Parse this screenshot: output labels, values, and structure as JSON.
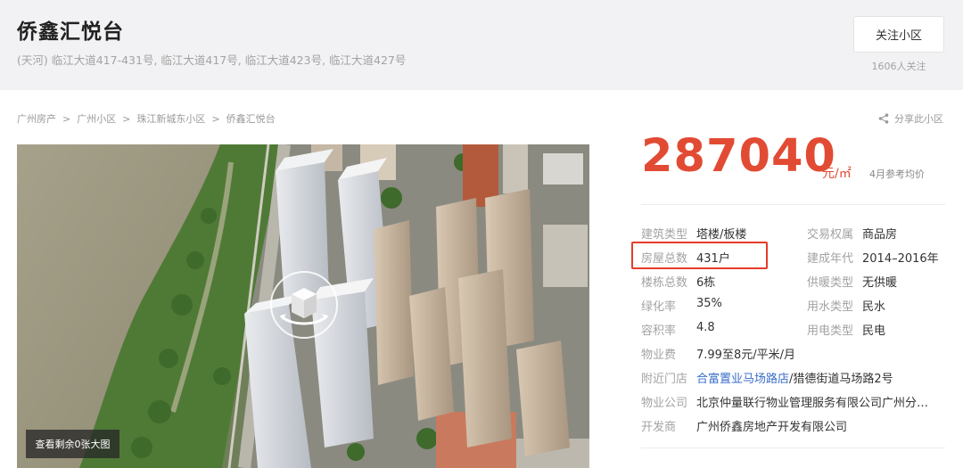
{
  "header": {
    "title": "侨鑫汇悦台",
    "address": "(天河) 临江大道417-431号, 临江大道417号, 临江大道423号, 临江大道427号",
    "follow_button": "关注小区",
    "follow_count": "1606人关注"
  },
  "breadcrumb": {
    "items": [
      "广州房产",
      "广州小区",
      "珠江新城东小区",
      "侨鑫汇悦台"
    ],
    "separator": ">"
  },
  "share": {
    "label": "分享此小区",
    "icon": "share-icon"
  },
  "photo": {
    "view_more_label": "查看剩余0张大图",
    "vr_icon": "vr-panorama-icon"
  },
  "price": {
    "value": "287040",
    "unit": "元/㎡",
    "note": "4月参考均价",
    "color": "#e24b33"
  },
  "info": {
    "left": [
      {
        "label": "建筑类型",
        "value": "塔楼/板楼"
      },
      {
        "label": "房屋总数",
        "value": "431户"
      },
      {
        "label": "楼栋总数",
        "value": "6栋"
      },
      {
        "label": "绿化率",
        "value": "35%"
      },
      {
        "label": "容积率",
        "value": "4.8"
      }
    ],
    "right": [
      {
        "label": "交易权属",
        "value": "商品房"
      },
      {
        "label": "建成年代",
        "value": "2014–2016年"
      },
      {
        "label": "供暖类型",
        "value": "无供暖"
      },
      {
        "label": "用水类型",
        "value": "民水"
      },
      {
        "label": "用电类型",
        "value": "民电"
      }
    ],
    "full": [
      {
        "label": "物业费",
        "value": "7.99至8元/平米/月"
      },
      {
        "label": "附近门店",
        "link": "合富置业马场路店",
        "value": "/猎德街道马场路2号"
      },
      {
        "label": "物业公司",
        "value": "北京仲量联行物业管理服务有限公司广州分…"
      },
      {
        "label": "开发商",
        "value": "广州侨鑫房地产开发有限公司"
      }
    ]
  },
  "colors": {
    "accent": "#e24b33",
    "highlight_border": "#e53c2c",
    "link": "#3a6cc8"
  }
}
